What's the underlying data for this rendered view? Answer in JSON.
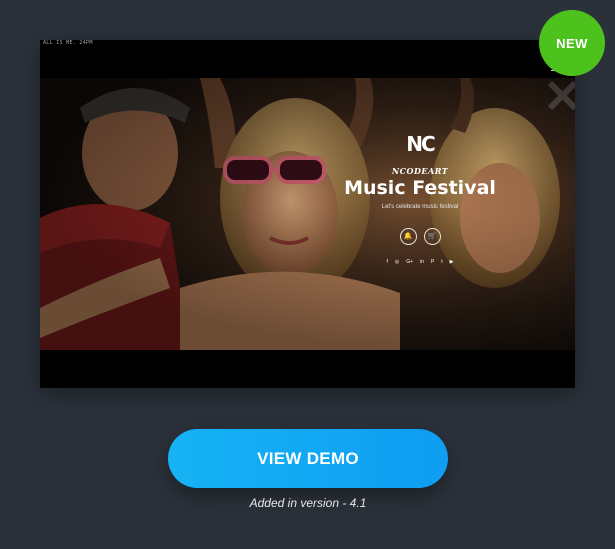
{
  "badge": {
    "label": "NEW",
    "color": "#4ec21c"
  },
  "preview": {
    "top_tiny_text": "ALL IS ME. 24PM",
    "menu_icon": "hamburger-menu-icon",
    "hero": {
      "logo": "NC",
      "brand": "NCODEART",
      "title": "Music Festival",
      "subtitle": "Let's celebrate music festival",
      "action_icons": [
        "bell-icon",
        "cart-icon"
      ],
      "action_glyphs": [
        "🔔",
        "🛒"
      ],
      "social_icons": [
        "facebook-icon",
        "dribbble-icon",
        "google-plus-icon",
        "linkedin-icon",
        "pinterest-icon",
        "twitter-icon",
        "youtube-icon"
      ],
      "social_glyphs": [
        "f",
        "◎",
        "G+",
        "in",
        "P",
        "t",
        "▶"
      ]
    }
  },
  "cta": {
    "label": "VIEW DEMO",
    "color": "#16b3f4"
  },
  "version_note": "Added in version - 4.1"
}
